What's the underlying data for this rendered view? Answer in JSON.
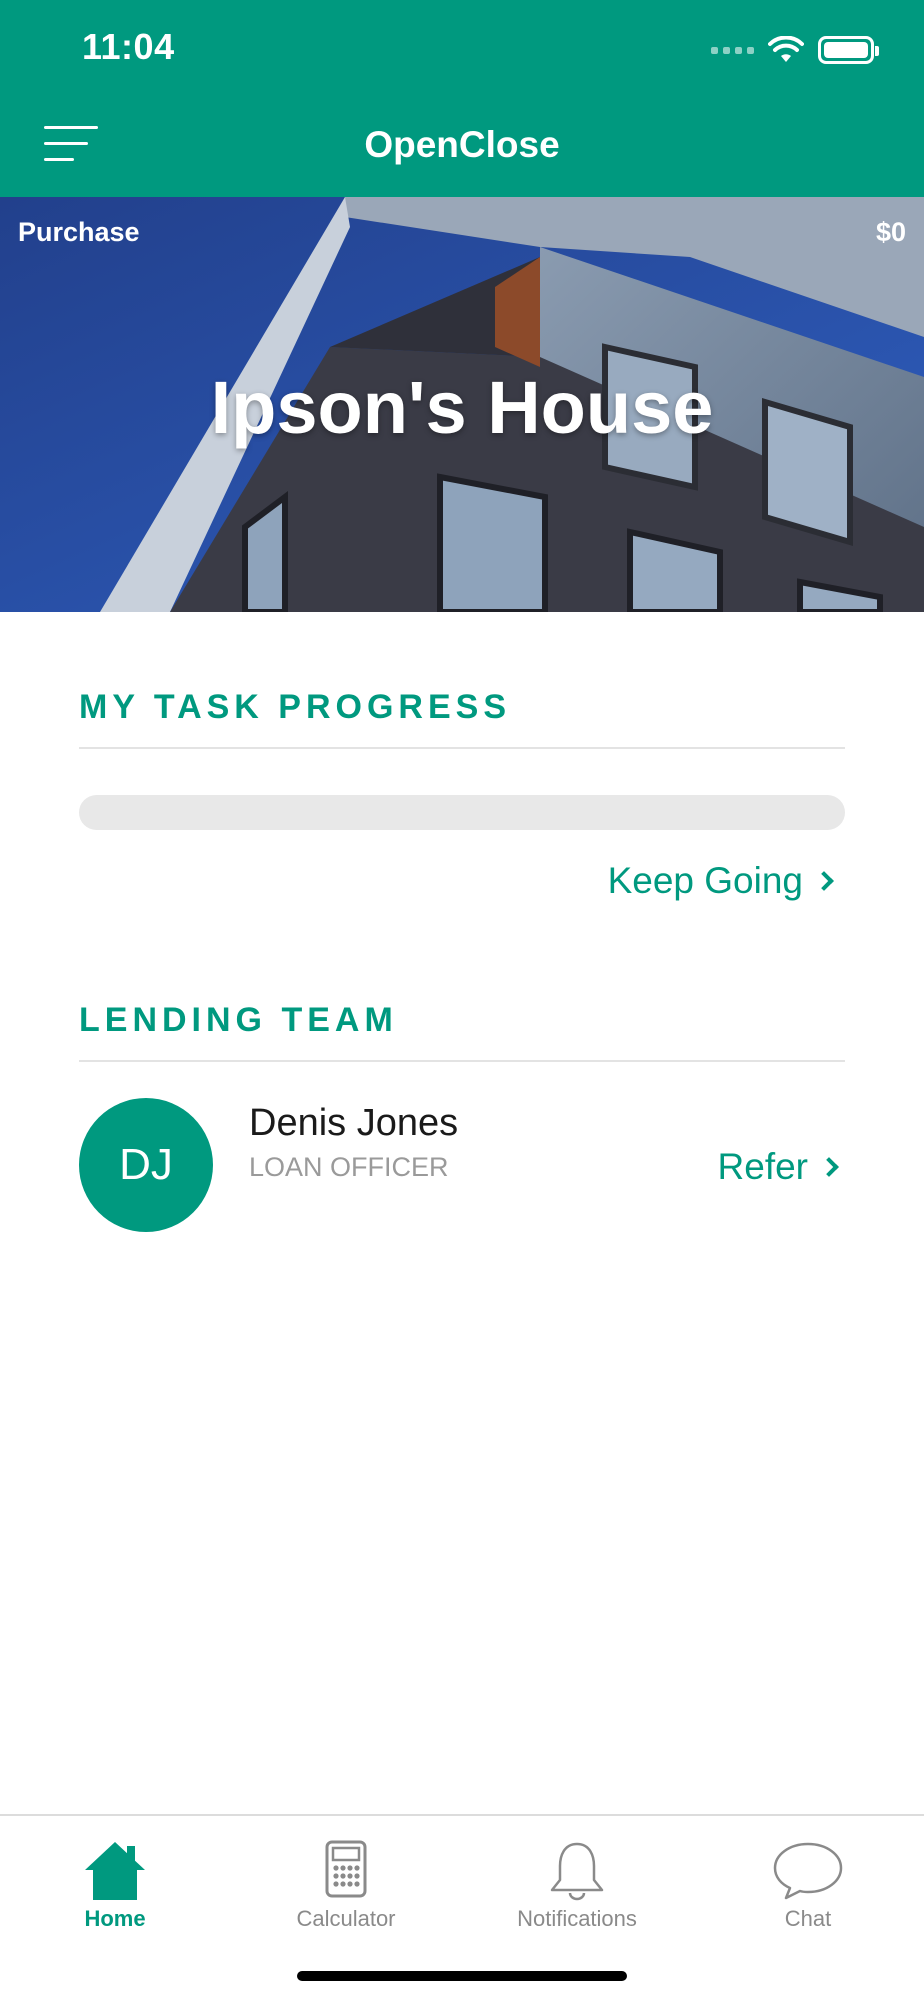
{
  "status_bar": {
    "time": "11:04"
  },
  "header": {
    "title": "OpenClose"
  },
  "hero": {
    "loan_type": "Purchase",
    "price": "$0",
    "title": "Ipson's House"
  },
  "task_progress": {
    "heading": "MY TASK PROGRESS",
    "progress_percent": 0,
    "action_label": "Keep Going"
  },
  "lending_team": {
    "heading": "LENDING TEAM",
    "members": [
      {
        "initials": "DJ",
        "name": "Denis Jones",
        "role": "LOAN OFFICER",
        "action_label": "Refer"
      }
    ]
  },
  "tabs": [
    {
      "label": "Home",
      "icon": "home-icon",
      "active": true
    },
    {
      "label": "Calculator",
      "icon": "calculator-icon",
      "active": false
    },
    {
      "label": "Notifications",
      "icon": "bell-icon",
      "active": false
    },
    {
      "label": "Chat",
      "icon": "chat-icon",
      "active": false
    }
  ],
  "colors": {
    "brand": "#00997f",
    "progress_track": "#e8e8e8",
    "inactive_tab": "#8a8a8a"
  }
}
